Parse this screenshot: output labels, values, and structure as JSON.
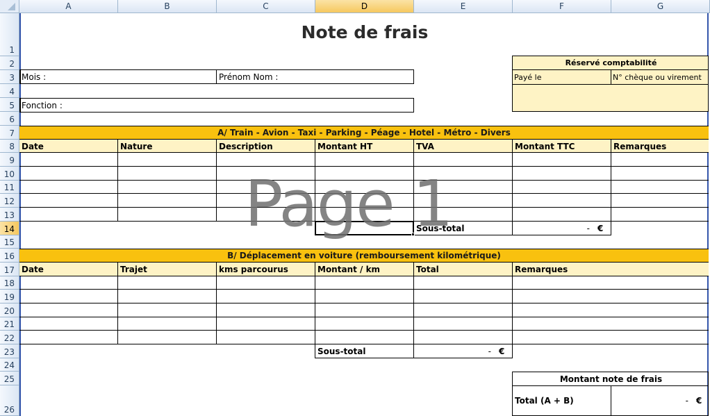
{
  "columns": [
    "A",
    "B",
    "C",
    "D",
    "E",
    "F",
    "G"
  ],
  "selected_column": "D",
  "rows": [
    "1",
    "2",
    "3",
    "4",
    "5",
    "6",
    "7",
    "8",
    "9",
    "10",
    "11",
    "12",
    "13",
    "14",
    "15",
    "16",
    "17",
    "18",
    "19",
    "20",
    "21",
    "22",
    "23",
    "24",
    "25",
    "26"
  ],
  "selected_row": "14",
  "sheet": {
    "title": "Note de frais",
    "reserve": {
      "header": "Réservé comptabilité",
      "paye_le": "Payé le",
      "cheque": "N° chèque ou virement"
    },
    "fields": {
      "mois": "Mois :",
      "prenom_nom": "Prénom Nom :",
      "fonction": "Fonction :"
    },
    "section_a": {
      "header": "A/ Train - Avion - Taxi - Parking - Péage - Hotel - Métro - Divers",
      "columns": [
        "Date",
        "Nature",
        "Description",
        "Montant HT",
        "TVA",
        "Montant TTC",
        "Remarques"
      ],
      "subtotal_label": "Sous-total",
      "subtotal_value": "-",
      "currency": "€"
    },
    "section_b": {
      "header": "B/ Déplacement en voiture (remboursement kilométrique)",
      "columns": [
        "Date",
        "Trajet",
        "kms parcourus",
        "Montant / km",
        "Total",
        "Remarques"
      ],
      "subtotal_label": "Sous-total",
      "subtotal_value": "-",
      "currency": "€"
    },
    "total": {
      "header": "Montant note de frais",
      "label": "Total (A + B)",
      "value": "-",
      "currency": "€"
    },
    "watermark": "Page 1"
  }
}
